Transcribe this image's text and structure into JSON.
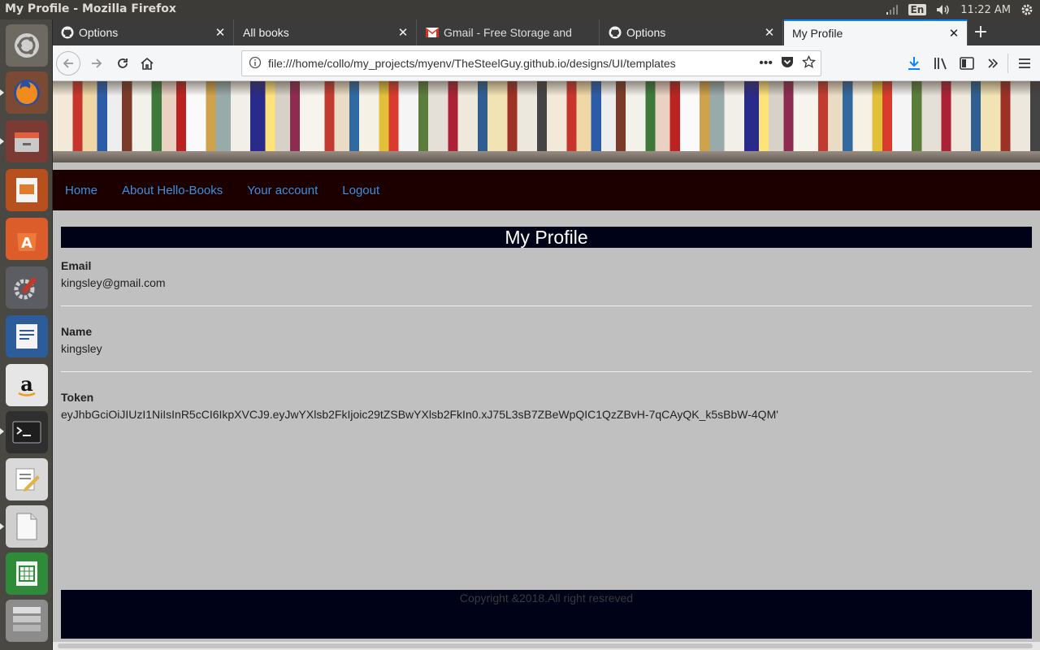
{
  "system": {
    "window_title": "My Profile - Mozilla Firefox",
    "lang": "En",
    "time": "11:22 AM"
  },
  "launcher": {
    "apps": [
      "ubuntu-dash-icon",
      "firefox-icon",
      "file-manager-icon",
      "impress-icon",
      "software-center-icon",
      "system-settings-icon",
      "writer-icon",
      "amazon-icon",
      "terminal-icon",
      "text-editor-icon",
      "document-viewer-icon",
      "calc-icon",
      "workspace-switcher-icon"
    ]
  },
  "tabs": [
    {
      "label": "Options",
      "icon": "github-icon"
    },
    {
      "label": "All books",
      "icon": ""
    },
    {
      "label": "Gmail - Free Storage and",
      "icon": "gmail-icon"
    },
    {
      "label": "Options",
      "icon": "github-icon"
    },
    {
      "label": "My Profile",
      "icon": "",
      "active": true
    }
  ],
  "toolbar": {
    "url": "file:///home/collo/my_projects/myenv/TheSteelGuy.github.io/designs/UI/templates"
  },
  "site": {
    "nav": [
      "Home",
      "About Hello-Books",
      "Your account",
      "Logout"
    ],
    "title": "My Profile",
    "email_label": "Email",
    "email_value": "kingsley@gmail.com",
    "name_label": "Name",
    "name_value": "kingsley",
    "token_label": "Token",
    "token_value": "eyJhbGciOiJIUzI1NiIsInR5cCI6IkpXVCJ9.eyJwYXlsb2FkIjoic29tZSBwYXlsb2FkIn0.xJ75L3sB7ZBeWpQIC1QzZBvH-7qCAyQK_k5sBbW-4QM'",
    "footer": "Copyright &2018.All right resreved"
  },
  "colors": {
    "nav_bg": "#1c0000",
    "nav_link": "#3d8fe0",
    "header_bg": "#000218",
    "page_bg": "#c0c0c0",
    "tab_accent": "#0a84ff"
  }
}
